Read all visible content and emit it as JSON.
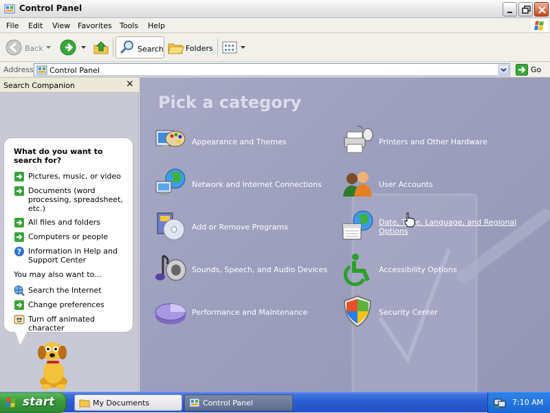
{
  "window": {
    "title": "Control Panel"
  },
  "menu": [
    "File",
    "Edit",
    "View",
    "Favorites",
    "Tools",
    "Help"
  ],
  "toolbar": {
    "back": "Back",
    "search": "Search",
    "folders": "Folders"
  },
  "address": {
    "label": "Address",
    "value": "Control Panel",
    "go": "Go"
  },
  "left_pane": {
    "title": "Search Companion",
    "close": "×",
    "question": "What do you want to search for?",
    "options": [
      "Pictures, music, or video",
      "Documents (word processing, spreadsheet, etc.)",
      "All files and folders",
      "Computers or people",
      "Information in Help and Support Center"
    ],
    "also_label": "You may also want to...",
    "also_options": [
      "Search the Internet",
      "Change preferences",
      "Turn off animated character"
    ]
  },
  "content": {
    "title": "Pick a category",
    "categories": [
      "Appearance and Themes",
      "Printers and Other Hardware",
      "Network and Internet Connections",
      "User Accounts",
      "Add or Remove Programs",
      "Date, Time, Language, and Regional Options",
      "Sounds, Speech, and Audio Devices",
      "Accessibility Options",
      "Performance and Maintenance",
      "Security Center"
    ]
  },
  "taskbar": {
    "start": "start",
    "buttons": [
      "My Documents",
      "Control Panel"
    ],
    "clock": "7:10 AM"
  },
  "colors": {
    "content_bg": "#a0a2c1",
    "left_pane_bg": "#c9c9d6",
    "taskbar_blue": "#2a5cd1",
    "start_green": "#3a9c3c",
    "category_text": "#ffffff"
  }
}
